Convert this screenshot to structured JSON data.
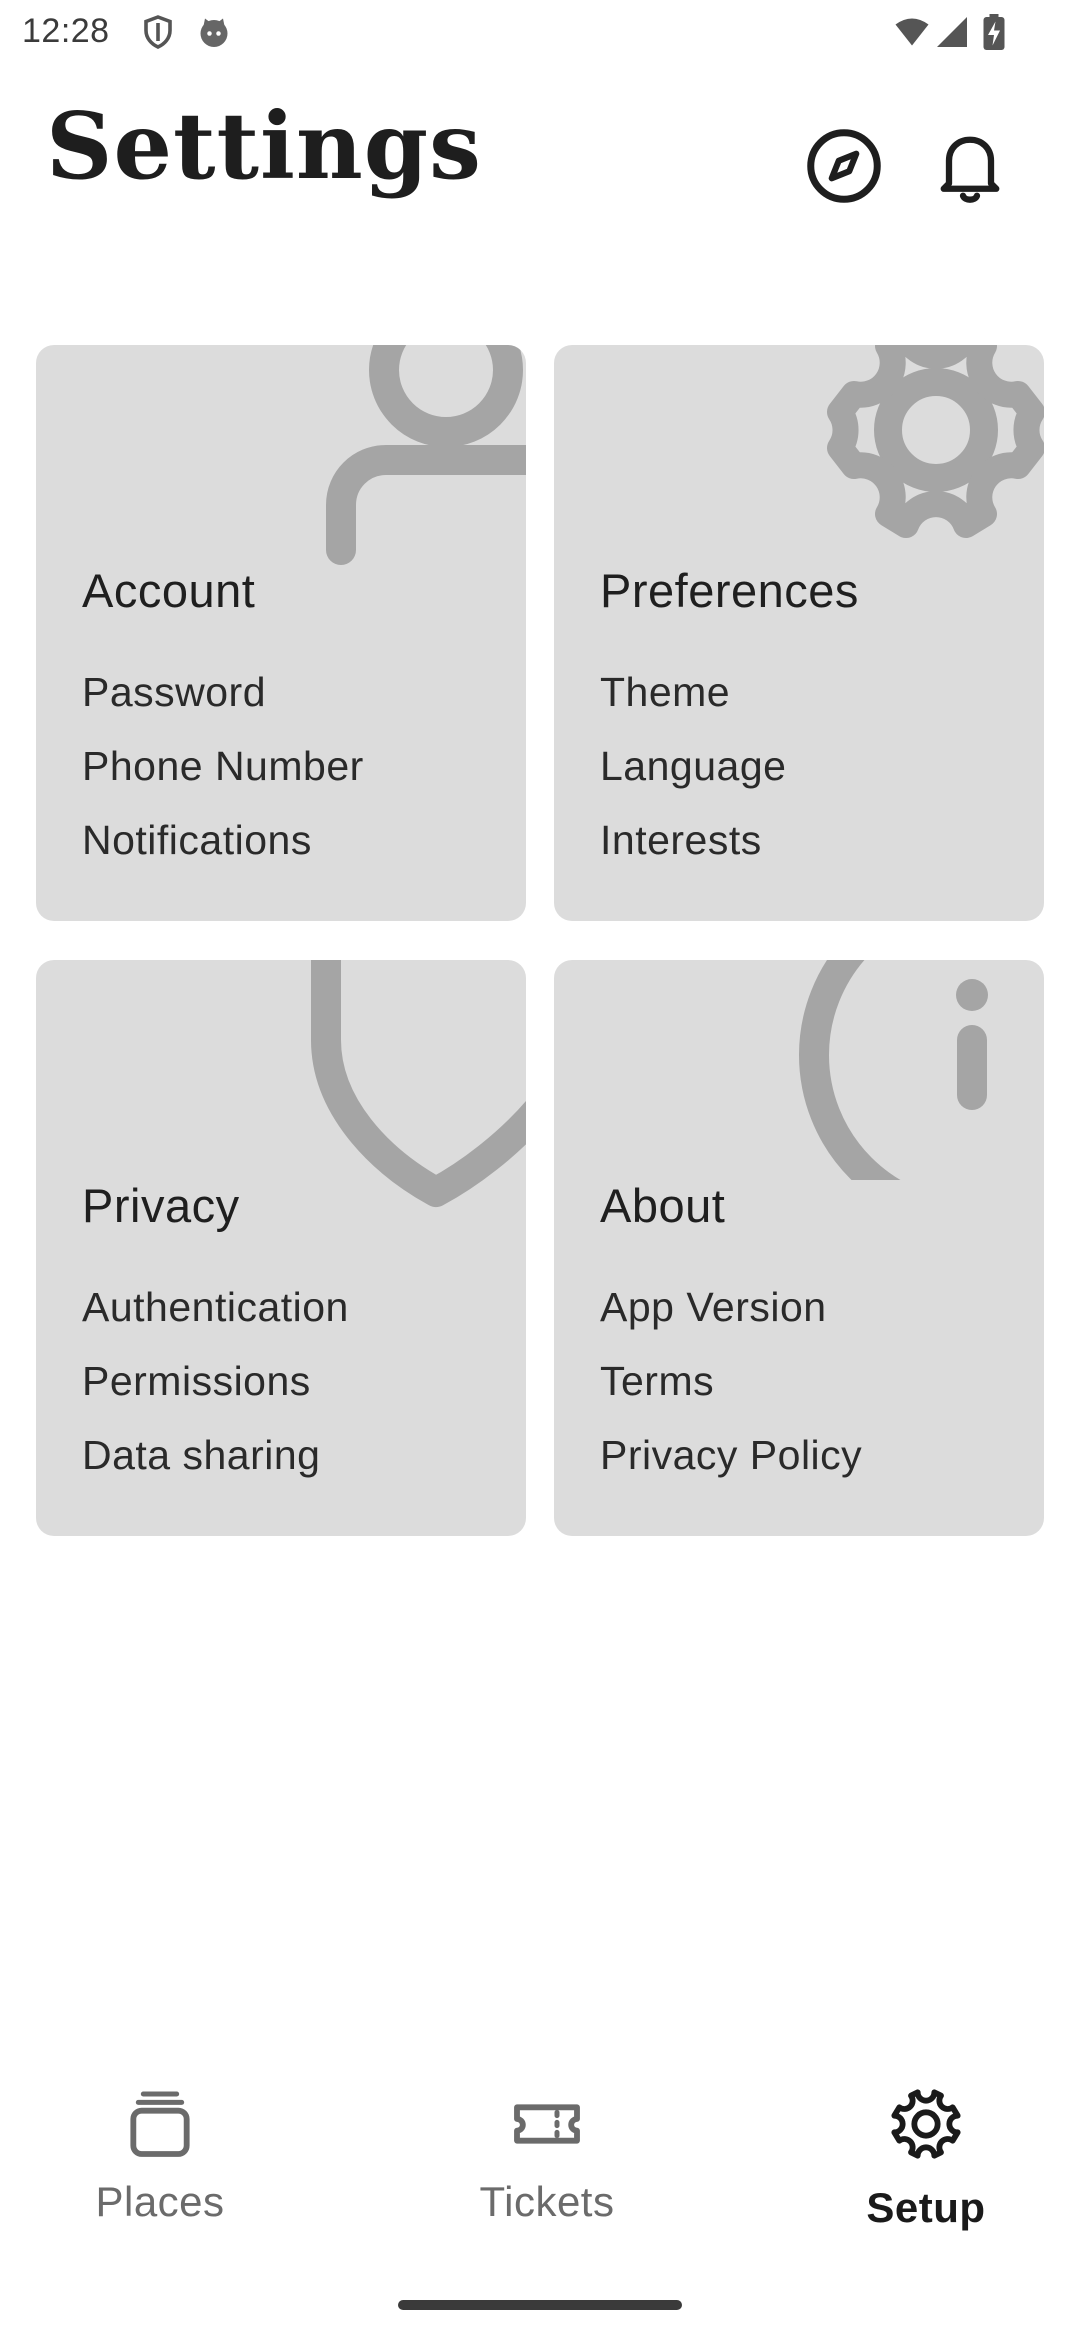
{
  "status_bar": {
    "time": "12:28",
    "icons_left": [
      "shield-icon",
      "cat-face-icon"
    ],
    "icons_right": [
      "wifi-icon",
      "cellular-signal-icon",
      "battery-charging-icon"
    ]
  },
  "header": {
    "title": "Settings",
    "actions": [
      {
        "name": "explore",
        "icon": "compass-icon"
      },
      {
        "name": "notifications",
        "icon": "bell-icon"
      }
    ]
  },
  "cards": [
    {
      "title": "Account",
      "icon": "person-icon",
      "items": [
        "Password",
        "Phone Number",
        "Notifications"
      ]
    },
    {
      "title": "Preferences",
      "icon": "gear-icon",
      "items": [
        "Theme",
        "Language",
        "Interests"
      ]
    },
    {
      "title": "Privacy",
      "icon": "shield-icon",
      "items": [
        "Authentication",
        "Permissions",
        "Data sharing"
      ]
    },
    {
      "title": "About",
      "icon": "info-icon",
      "items": [
        "App Version",
        "Terms",
        "Privacy Policy"
      ]
    }
  ],
  "bottom_nav": {
    "items": [
      {
        "label": "Places",
        "icon": "stacked-cards-icon",
        "active": false
      },
      {
        "label": "Tickets",
        "icon": "ticket-icon",
        "active": false
      },
      {
        "label": "Setup",
        "icon": "gear-icon",
        "active": true
      }
    ]
  },
  "colors": {
    "card_background": "#dcdcdc",
    "card_icon": "#a5a5a5",
    "text_primary": "#1f1f1f",
    "nav_inactive": "#6b6b6b",
    "nav_active": "#1a1a1a"
  }
}
